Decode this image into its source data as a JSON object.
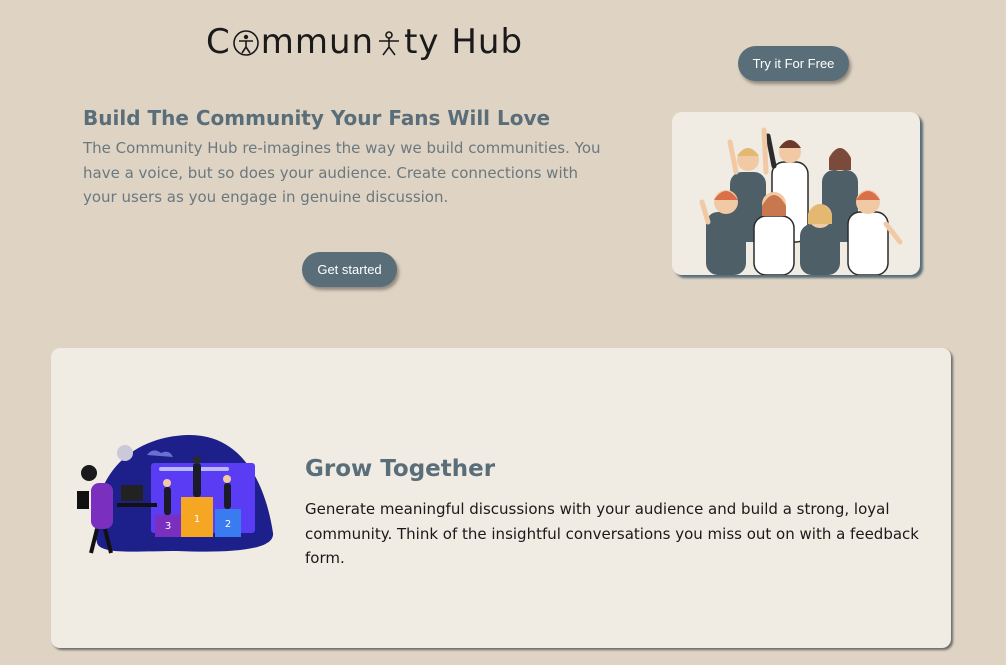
{
  "brand": {
    "logo_before": "C",
    "logo_middle": "mmun",
    "logo_after": "ty Hub",
    "logo_icon": "person-icon"
  },
  "header": {
    "try_button": "Try it For Free"
  },
  "hero": {
    "title": "Build The Community Your Fans Will Love",
    "text": "The Community Hub re-imagines the way we build communities. You have a voice, but so does your audience. Create connections with your users as you engage in genuine discussion.",
    "cta": "Get started",
    "image_icon": "cheering-crowd-illustration"
  },
  "feature": {
    "title": "Grow Together",
    "text": "Generate meaningful discussions with your audience and build a strong, loyal community. Think of the insightful conversations you miss out on with a feedback form.",
    "image_icon": "podium-illustration",
    "podium_labels": [
      "1",
      "2",
      "3"
    ]
  },
  "colors": {
    "background": "#dfd3c3",
    "card": "#f0ebe3",
    "accent": "#596e79",
    "text_muted": "#6a7880"
  }
}
